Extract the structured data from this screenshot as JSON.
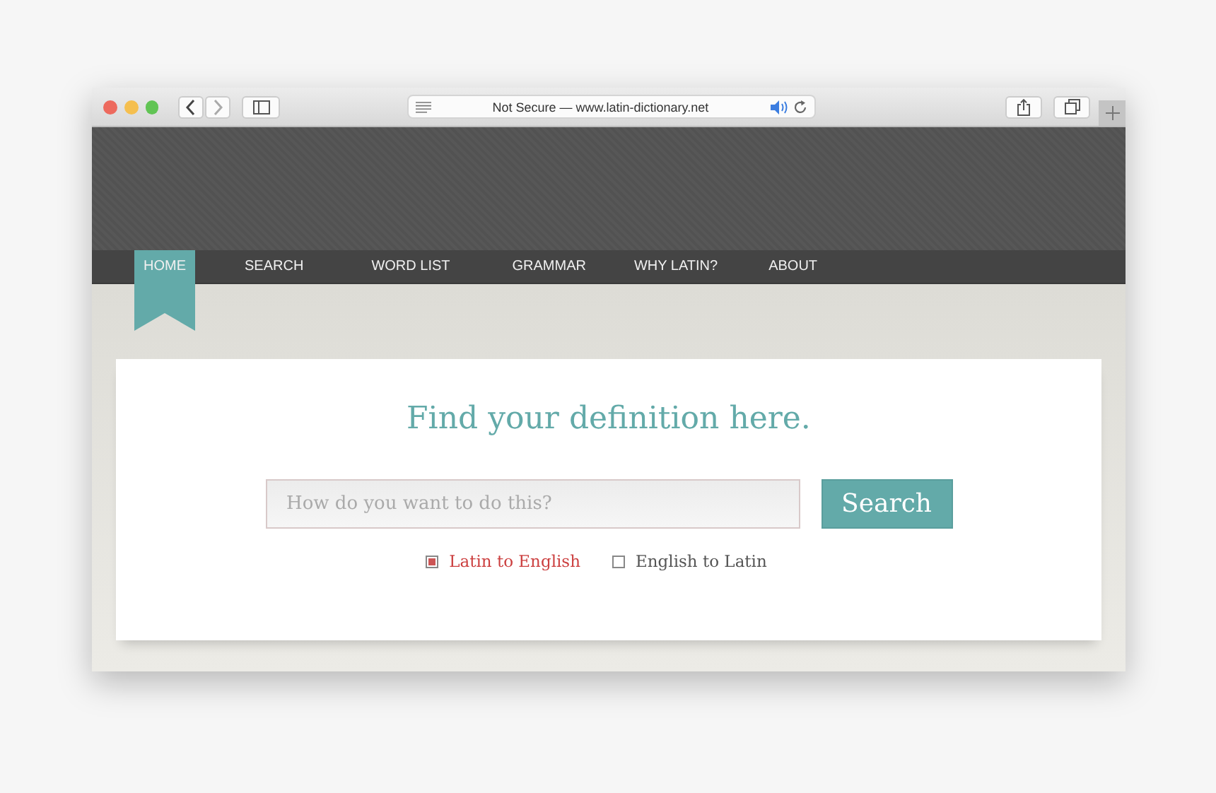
{
  "browser": {
    "address": "Not Secure — www.latin-dictionary.net"
  },
  "nav": {
    "tabs": [
      {
        "label": "HOME",
        "selected": true
      },
      {
        "label": "SEARCH",
        "selected": false
      },
      {
        "label": "WORD LIST",
        "selected": false
      },
      {
        "label": "GRAMMAR",
        "selected": false
      },
      {
        "label": "WHY LATIN?",
        "selected": false
      },
      {
        "label": "ABOUT",
        "selected": false
      }
    ]
  },
  "main": {
    "heading": "Find your definition here.",
    "search": {
      "placeholder": "How do you want to do this?"
    },
    "button": "Search",
    "options": [
      {
        "label": "Latin to English",
        "selected": true
      },
      {
        "label": "English to Latin",
        "selected": false
      }
    ]
  }
}
